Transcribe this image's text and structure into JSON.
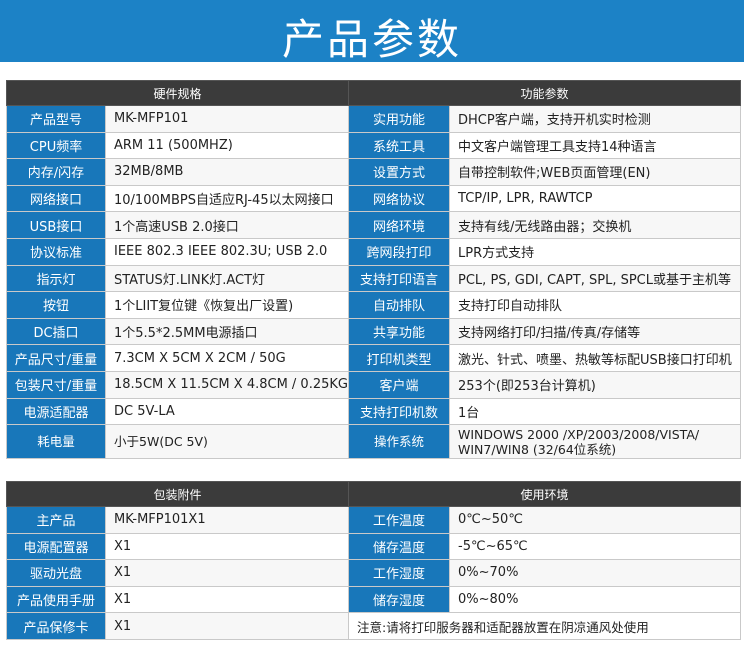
{
  "banner": {
    "title": "产品参数"
  },
  "hardware": {
    "header": "硬件规格",
    "rows": [
      {
        "label": "产品型号",
        "value": "MK-MFP101"
      },
      {
        "label": "CPU频率",
        "value": "ARM 11 (500MHZ)"
      },
      {
        "label": "内存/闪存",
        "value": "32MB/8MB"
      },
      {
        "label": "网络接口",
        "value": "10/100MBPS自适应RJ-45以太网接口"
      },
      {
        "label": "USB接口",
        "value": "1个高速USB 2.0接口"
      },
      {
        "label": "协议标准",
        "value": "IEEE 802.3 IEEE 802.3U; USB 2.0"
      },
      {
        "label": "指示灯",
        "value": "STATUS灯.LINK灯.ACT灯"
      },
      {
        "label": "按钮",
        "value": "1个LIIT复位键《恢复出厂设置)"
      },
      {
        "label": "DC插口",
        "value": "1个5.5*2.5MM电源插口"
      },
      {
        "label": "产品尺寸/重量",
        "value": "7.3CM X 5CM X 2CM / 50G"
      },
      {
        "label": "包装尺寸/重量",
        "value": "18.5CM X 11.5CM X 4.8CM / 0.25KG"
      },
      {
        "label": "电源适配器",
        "value": "DC 5V-LA"
      },
      {
        "label": "耗电量",
        "value": "小于5W(DC 5V)"
      }
    ]
  },
  "function": {
    "header": "功能参数",
    "rows": [
      {
        "label": "实用功能",
        "value": "DHCP客户端，支持开机实时检测"
      },
      {
        "label": "系统工具",
        "value": "中文客户端管理工具支持14种语言"
      },
      {
        "label": "设置方式",
        "value": "自带控制软件;WEB页面管理(EN)"
      },
      {
        "label": "网络协议",
        "value": "TCP/IP, LPR, RAWTCP"
      },
      {
        "label": "网络环境",
        "value": "支持有线/无线路由器；交换机"
      },
      {
        "label": "跨网段打印",
        "value": "LPR方式支持"
      },
      {
        "label": "支持打印语言",
        "value": "PCL, PS, GDI, CAPT, SPL, SPCL或基于主机等"
      },
      {
        "label": "自动排队",
        "value": "支持打印自动排队"
      },
      {
        "label": "共享功能",
        "value": "支持网络打印/扫描/传真/存储等"
      },
      {
        "label": "打印机类型",
        "value": "激光、针式、喷墨、热敏等标配USB接口打印机"
      },
      {
        "label": "客户端",
        "value": "253个(即253台计算机)"
      },
      {
        "label": "支持打印机数",
        "value": "1台"
      },
      {
        "label": "操作系统",
        "value": "WINDOWS 2000 /XP/2003/2008/VISTA/ WIN7/WIN8 (32/64位系统)"
      }
    ]
  },
  "accessories": {
    "header": "包装附件",
    "rows": [
      {
        "label": "主产品",
        "value": "MK-MFP101X1"
      },
      {
        "label": "电源配置器",
        "value": "X1"
      },
      {
        "label": "驱动光盘",
        "value": "X1"
      },
      {
        "label": "产品使用手册",
        "value": "X1"
      },
      {
        "label": "产品保修卡",
        "value": "X1"
      }
    ]
  },
  "environment": {
    "header": "使用环境",
    "rows": [
      {
        "label": "工作温度",
        "value": "0℃~50℃"
      },
      {
        "label": "储存温度",
        "value": "-5℃~65℃"
      },
      {
        "label": "工作湿度",
        "value": "0%~70%"
      },
      {
        "label": "储存湿度",
        "value": "0%~80%"
      }
    ],
    "note": "注意:请将打印服务器和适配器放置在阴凉通风处使用"
  }
}
